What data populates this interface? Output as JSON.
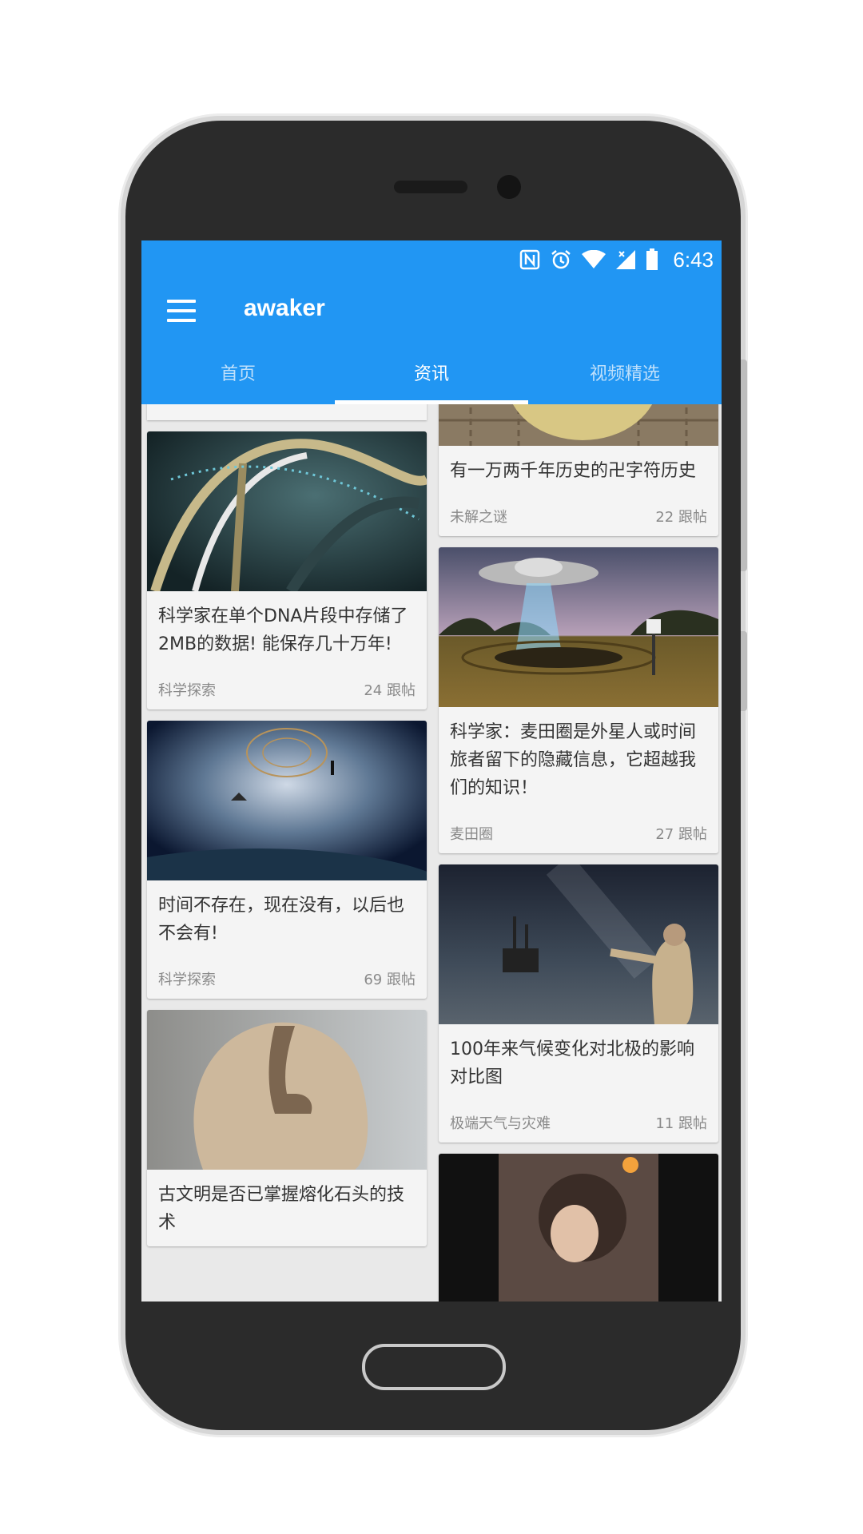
{
  "app": {
    "title": "awaker"
  },
  "status_bar": {
    "time": "6:43",
    "icons": [
      "nfc-icon",
      "alarm-icon",
      "wifi-icon",
      "signal-icon",
      "battery-icon"
    ]
  },
  "tabs": [
    {
      "label": "首页",
      "active": false
    },
    {
      "label": "资讯",
      "active": true
    },
    {
      "label": "视频精选",
      "active": false
    }
  ],
  "colors": {
    "primary": "#2196f3",
    "card": "#f4f4f4",
    "text": "#333333",
    "meta": "#8a8a8a"
  },
  "feed": {
    "left": [
      {
        "title": "科学家在单个DNA片段中存储了2MB的数据! 能保存几十万年!",
        "category": "科学探索",
        "replies": "24 跟帖",
        "image": "dna-helix-image"
      },
      {
        "title": "时间不存在，现在没有，以后也不会有!",
        "category": "科学探索",
        "replies": "69 跟帖",
        "image": "space-vortex-image"
      },
      {
        "title": "古文明是否已掌握熔化石头的技术",
        "category": "",
        "replies": "",
        "image": "melted-stone-image"
      }
    ],
    "right": [
      {
        "title": "有一万两千年历史的卍字符历史",
        "category": "未解之谜",
        "replies": "22 跟帖",
        "image": "ancient-mosaic-image"
      },
      {
        "title": "科学家：麦田圈是外星人或时间旅者留下的隐藏信息，它超越我们的知识！",
        "category": "麦田圈",
        "replies": "27 跟帖",
        "image": "ufo-crop-circle-image"
      },
      {
        "title": "100年来气候变化对北极的影响对比图",
        "category": "极端天气与灾难",
        "replies": "11 跟帖",
        "image": "arctic-night-image"
      },
      {
        "title": "",
        "category": "",
        "replies": "",
        "image": "child-video-image"
      }
    ]
  }
}
